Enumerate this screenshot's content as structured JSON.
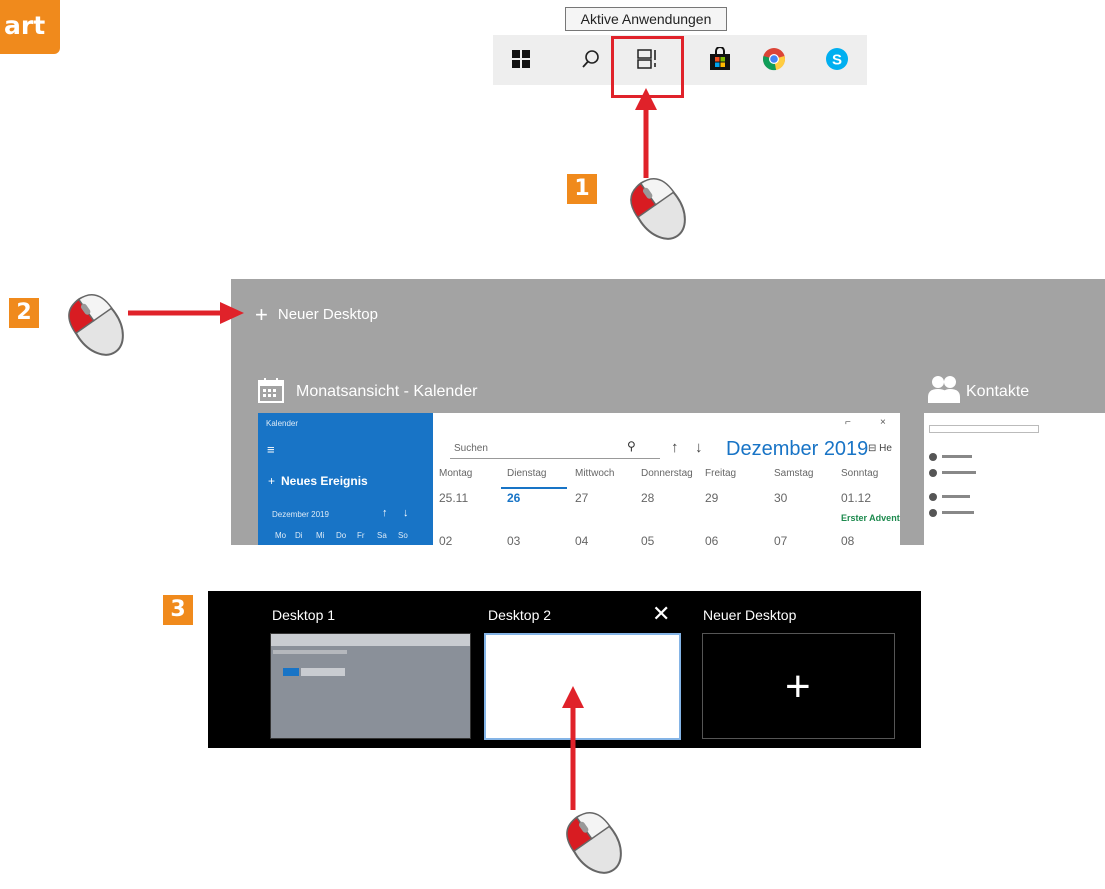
{
  "corner_label": "art",
  "steps": [
    "1",
    "2",
    "3"
  ],
  "taskbar": {
    "tooltip": "Aktive Anwendungen",
    "icons": [
      "windows-start-icon",
      "search-icon",
      "task-view-icon",
      "store-icon",
      "chrome-icon",
      "skype-icon"
    ]
  },
  "virtual_desktop_view": {
    "new_desktop_button": "Neuer Desktop",
    "calendar_window": {
      "title": "Monatsansicht - Kalender",
      "app_name": "Kalender",
      "new_event": "Neues Ereignis",
      "mini_month": "Dezember 2019",
      "mini_weekdays": [
        "Mo",
        "Di",
        "Mi",
        "Do",
        "Fr",
        "Sa",
        "So"
      ],
      "search_placeholder": "Suchen",
      "month_title": "Dezember 2019",
      "today_button": "He",
      "weekdays": [
        "Montag",
        "Dienstag",
        "Mittwoch",
        "Donnerstag",
        "Freitag",
        "Samstag",
        "Sonntag"
      ],
      "week1_dates": [
        "25.11",
        "26",
        "27",
        "28",
        "29",
        "30",
        "01.12"
      ],
      "week2_dates": [
        "02",
        "03",
        "04",
        "05",
        "06",
        "07",
        "08"
      ],
      "event": "Erster Advent"
    },
    "contacts_window": {
      "title": "Kontakte"
    }
  },
  "desktop_switcher": {
    "desktops": [
      {
        "label": "Desktop 1"
      },
      {
        "label": "Desktop 2"
      },
      {
        "label": "Neuer Desktop"
      }
    ]
  },
  "colors": {
    "accent_orange": "#f08a1c",
    "arrow_red": "#e0222a",
    "calendar_blue": "#1874c6"
  }
}
